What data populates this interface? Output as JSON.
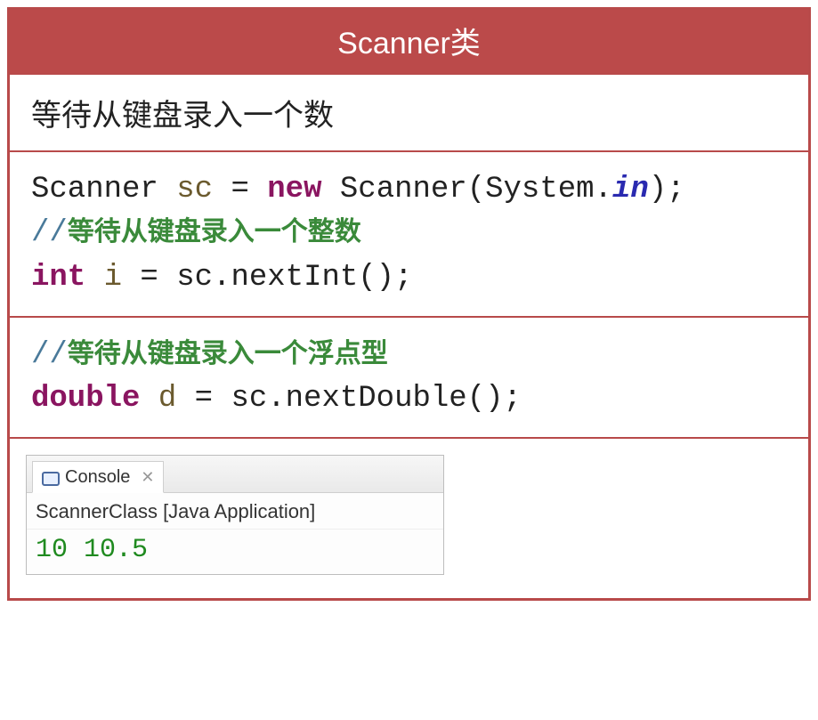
{
  "header": {
    "title": "Scanner类"
  },
  "description": "等待从键盘录入一个数",
  "code_block_1": {
    "type1": "Scanner",
    "var1": "sc",
    "eq": " = ",
    "kw_new": "new",
    "ctor": " Scanner(System.",
    "in": "in",
    "end": ");",
    "comment1_slash": "//",
    "comment1_text": "等待从键盘录入一个整数",
    "type2": "int",
    "var2": "i",
    "rest2": " = sc.nextInt();"
  },
  "code_block_2": {
    "comment2_slash": "//",
    "comment2_text": "等待从键盘录入一个浮点型",
    "type3": "double",
    "var3": "d",
    "rest3": " = sc.nextDouble();"
  },
  "console": {
    "tab_label": "Console",
    "close_glyph": "✕",
    "run_label": "ScannerClass [Java Application]",
    "output": "10 10.5"
  }
}
